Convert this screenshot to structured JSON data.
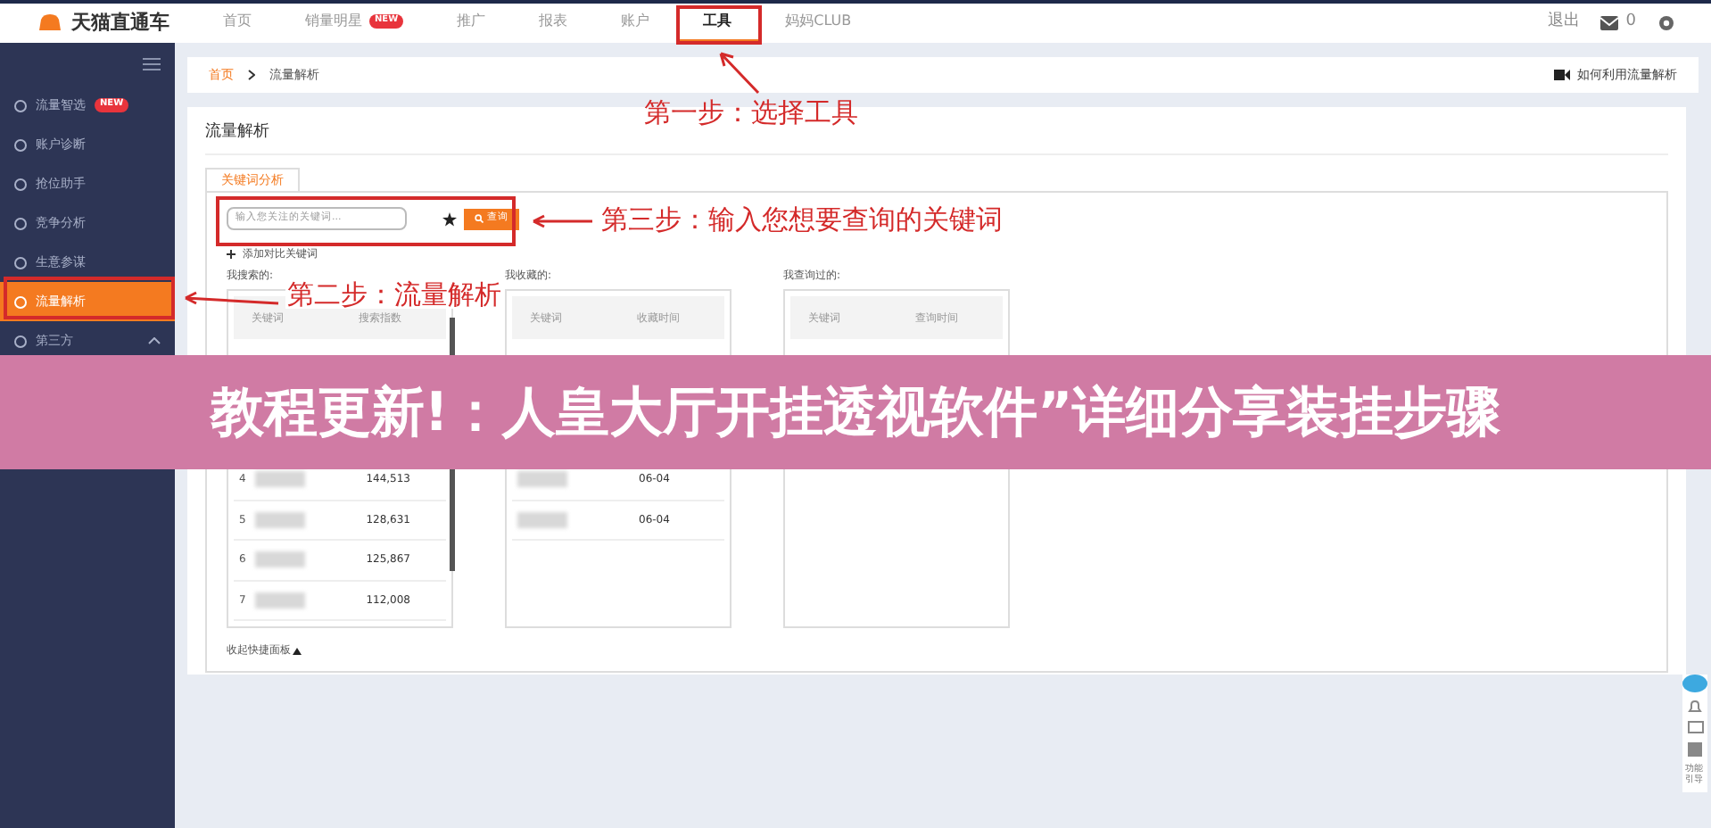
{
  "nav": {
    "logo": "天猫直通车",
    "tabs": [
      {
        "label": "首页",
        "selected": false
      },
      {
        "label": "销量明星",
        "badge": "NEW",
        "selected": false
      },
      {
        "label": "推广",
        "selected": false
      },
      {
        "label": "报表",
        "selected": false
      },
      {
        "label": "账户",
        "selected": false
      },
      {
        "label": "工具",
        "selected": true
      },
      {
        "label": "妈妈CLUB",
        "selected": false
      }
    ],
    "logout": "退出",
    "mail_count": "0"
  },
  "sidebar": {
    "items": [
      {
        "label": "流量智选",
        "badge": "NEW",
        "selected": false
      },
      {
        "label": "账户诊断",
        "selected": false
      },
      {
        "label": "抢位助手",
        "selected": false
      },
      {
        "label": "竞争分析",
        "selected": false
      },
      {
        "label": "生意参谋",
        "selected": false
      },
      {
        "label": "流量解析",
        "selected": true
      },
      {
        "label": "第三方",
        "selected": false,
        "expanded": true
      }
    ]
  },
  "breadcrumb": [
    "首页",
    "流量解析"
  ],
  "help_link": "如何利用流量解析",
  "card": {
    "title": "流量解析",
    "tab": "关键词分析",
    "search": {
      "placeholder": "输入您关注的关键词...",
      "button": "查询"
    },
    "add_compare": "添加对比关键词",
    "panels": [
      {
        "label": "我搜索的:",
        "columns": [
          "关键词",
          "搜索指数"
        ],
        "rows": [
          {
            "index": "4",
            "value": "144,513"
          },
          {
            "index": "5",
            "value": "128,631"
          },
          {
            "index": "6",
            "value": "125,867"
          },
          {
            "index": "7",
            "value": "112,008"
          }
        ]
      },
      {
        "label": "我收藏的:",
        "columns": [
          "关键词",
          "收藏时间"
        ],
        "rows": [
          {
            "value": "06-04"
          },
          {
            "value": "06-04"
          }
        ]
      },
      {
        "label": "我查询过的:",
        "columns": [
          "关键词",
          "查询时间"
        ]
      }
    ],
    "collapse": "收起快捷面板"
  },
  "annotations": [
    {
      "kind": "nav",
      "text": "第一步：选择工具"
    },
    {
      "kind": "sidebar",
      "text": "第二步：流量解析"
    },
    {
      "kind": "search",
      "text": "第三步：输入您想要查询的关键词"
    }
  ],
  "banner": "教程更新!：人皇大厅开挂透视软件”详细分享装挂步骤",
  "side_widget": {
    "label": "功能引导"
  }
}
